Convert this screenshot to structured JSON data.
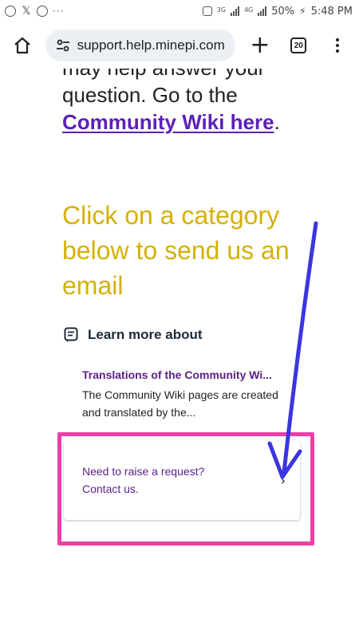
{
  "status_bar": {
    "left_icons": [
      "viber-icon",
      "x-icon",
      "whatsapp-icon"
    ],
    "more": "···",
    "network_labels": [
      "3G",
      "4G"
    ],
    "battery": "50%",
    "time": "5:48 PM"
  },
  "browser": {
    "url": "support.help.minepi.com",
    "tab_count": "20"
  },
  "page": {
    "partial_line": "may help answer your",
    "para_line2": "question. Go to the",
    "wiki_link": "Community Wiki here",
    "wiki_suffix": ".",
    "cta_heading": "Click on a category below to send us an email",
    "learn_more": "Learn more about",
    "article_title": "Translations of the Community Wi...",
    "article_snippet": "The Community Wiki pages are created and translated by the...",
    "request_line1": "Need to raise a request?",
    "request_line2": "Contact us."
  },
  "colors": {
    "heading": "#d4b106",
    "link": "#5b21b6",
    "highlight": "#ef3ea6",
    "arrow": "#3b35e0"
  }
}
